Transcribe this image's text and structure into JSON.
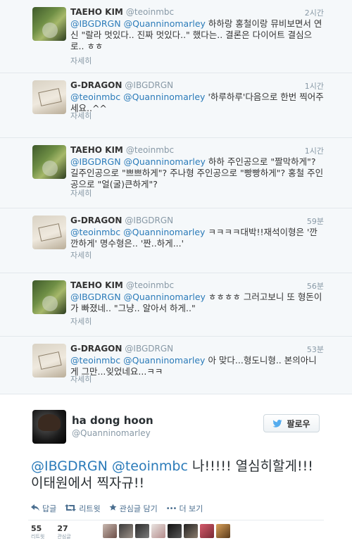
{
  "thread": [
    {
      "name": "TAEHO KIM",
      "handle": "@teoinmbc",
      "time": "2시간",
      "avatar": "nature",
      "parts": [
        {
          "t": "@IBGDRGN",
          "m": true
        },
        {
          "t": " ",
          "m": false
        },
        {
          "t": "@Quanninomarley",
          "m": true
        },
        {
          "t": " 하하랑 홍철이랑 뮤비보면서 연신 \"랄라 멋있다.. 진짜 멋있다..\" 했다는.. 결론은 다이어트 결심으로.. ㅎㅎ",
          "m": false
        }
      ],
      "details": "자세히"
    },
    {
      "name": "G-DRAGON",
      "handle": "@IBGDRGN",
      "time": "1시간",
      "avatar": "card",
      "parts": [
        {
          "t": "@teoinmbc",
          "m": true
        },
        {
          "t": " ",
          "m": false
        },
        {
          "t": "@Quanninomarley",
          "m": true
        },
        {
          "t": " '하루하루'다음으로 한번 찍어주세요..^^",
          "m": false
        }
      ],
      "details": "자세히"
    },
    {
      "name": "TAEHO KIM",
      "handle": "@teoinmbc",
      "time": "1시간",
      "avatar": "nature",
      "parts": [
        {
          "t": "@IBGDRGN",
          "m": true
        },
        {
          "t": " ",
          "m": false
        },
        {
          "t": "@Quanninomarley",
          "m": true
        },
        {
          "t": " 하하 주인공으로 \"짤막하게\"? 길주인공으로 \"쁘쁘하게\"? 주나형 주인공으로 \"빵빵하게\"? 홍철 주인공으로 \"얼(굴)큰하게\"?",
          "m": false
        }
      ],
      "details": "자세히"
    },
    {
      "name": "G-DRAGON",
      "handle": "@IBGDRGN",
      "time": "59분",
      "avatar": "card",
      "parts": [
        {
          "t": "@teoinmbc",
          "m": true
        },
        {
          "t": " ",
          "m": false
        },
        {
          "t": "@Quanninomarley",
          "m": true
        },
        {
          "t": " ㅋㅋㅋㅋ대박!!재석이형은 '깐깐하게' 명수형은.. '짠..하게...'",
          "m": false
        }
      ],
      "details": "자세히"
    },
    {
      "name": "TAEHO KIM",
      "handle": "@teoinmbc",
      "time": "56분",
      "avatar": "nature",
      "parts": [
        {
          "t": "@IBGDRGN",
          "m": true
        },
        {
          "t": " ",
          "m": false
        },
        {
          "t": "@Quanninomarley",
          "m": true
        },
        {
          "t": " ㅎㅎㅎㅎ 그러고보니 또 형돈이가 빠졌네.. \"그냥.. 알아서 하게..\"",
          "m": false
        }
      ],
      "details": "자세히"
    },
    {
      "name": "G-DRAGON",
      "handle": "@IBGDRGN",
      "time": "53분",
      "avatar": "card",
      "parts": [
        {
          "t": "@teoinmbc",
          "m": true
        },
        {
          "t": " ",
          "m": false
        },
        {
          "t": "@Quanninomarley",
          "m": true
        },
        {
          "t": " 아 맞다...형도니형.. 본의아니게 그만...잊었네요...ㅋㅋ",
          "m": false
        }
      ],
      "details": "자세히"
    }
  ],
  "main": {
    "name": "ha dong hoon",
    "handle": "@Quanninomarley",
    "follow_label": "팔로우",
    "mention1": "@IBGDRGN",
    "mention2": "@teoinmbc",
    "text": " 나!!!!! 열심히할게!!! 이태원에서 찍자규!!",
    "actions": {
      "reply": "답글",
      "retweet": "리트윗",
      "favorite": "관심글 담기",
      "more": "더 보기"
    },
    "stats": [
      {
        "num": "55",
        "label": "리트윗"
      },
      {
        "num": "27",
        "label": "관심글"
      }
    ]
  },
  "colors": {
    "mention": "#2b7bb9",
    "thread_bg": "#f5f8fa",
    "action": "#4a6e8f"
  }
}
